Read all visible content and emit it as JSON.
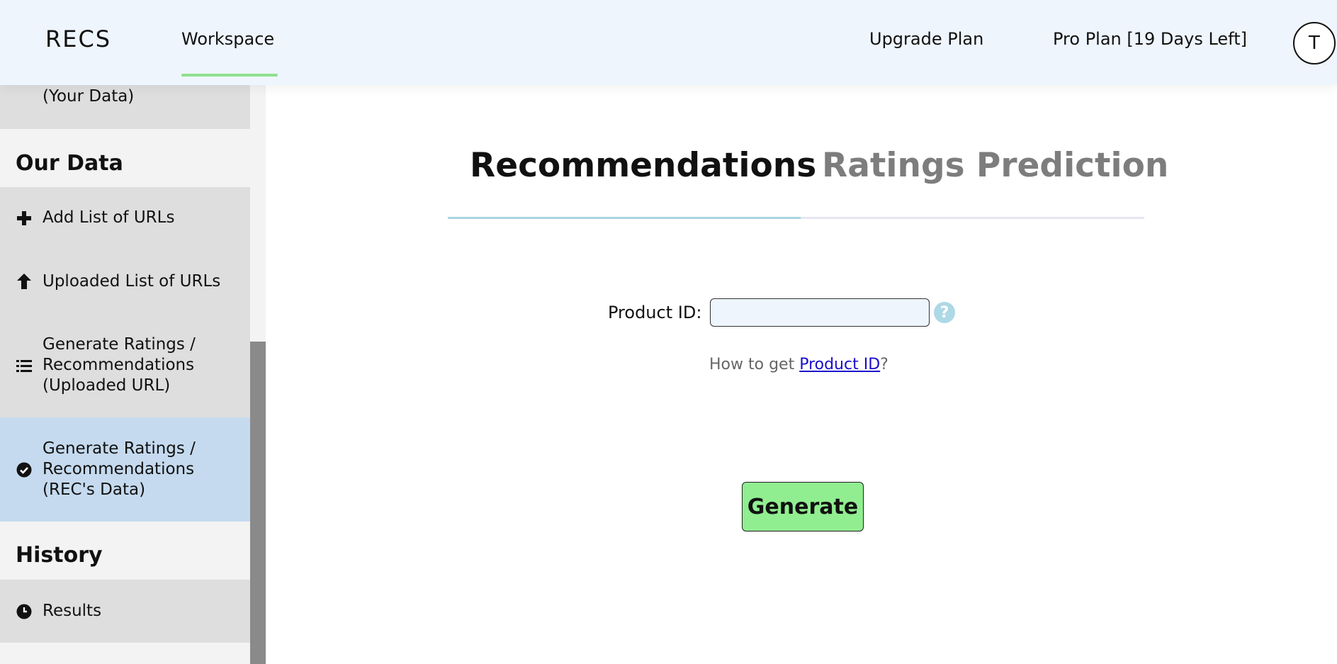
{
  "header": {
    "logo": "RECS",
    "nav_workspace": "Workspace",
    "upgrade": "Upgrade Plan",
    "plan_status": "Pro Plan [19 Days Left]",
    "avatar_initial": "T",
    "accent_color": "#90e090"
  },
  "sidebar": {
    "top_item_partial": "(Your Data)",
    "section_our_data": "Our Data",
    "items": [
      {
        "icon": "plus-icon",
        "label": "Add List of URLs"
      },
      {
        "icon": "arrow-up-icon",
        "label": "Uploaded List of URLs"
      },
      {
        "icon": "list-icon",
        "label_lines": [
          "Generate Ratings /",
          "Recommendations",
          "(Uploaded URL)"
        ]
      },
      {
        "icon": "check-circle-icon",
        "label_lines": [
          "Generate Ratings /",
          "Recommendations",
          "(REC's Data)"
        ],
        "active": true
      }
    ],
    "section_history": "History",
    "history_items": [
      {
        "icon": "clock-icon",
        "label": "Results"
      }
    ],
    "active_color": "#c5daee"
  },
  "main": {
    "tabs": [
      {
        "label": "Recommendations",
        "active": true
      },
      {
        "label": "Ratings Prediction",
        "active": false
      }
    ],
    "product_id_label": "Product ID:",
    "product_id_value": "",
    "help_symbol": "?",
    "howto_prefix": "How to get ",
    "howto_link": "Product ID",
    "howto_suffix": "?",
    "generate_label": "Generate",
    "generate_color": "#90ee90"
  }
}
